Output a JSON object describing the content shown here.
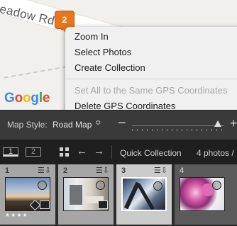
{
  "map": {
    "road_label": "eadow Rd",
    "road_label_tail": "G",
    "pin_count": "2",
    "provider_logo": "Google"
  },
  "context_menu": {
    "items": [
      {
        "label": "Zoom In",
        "enabled": true
      },
      {
        "label": "Select Photos",
        "enabled": true
      },
      {
        "label": "Create Collection",
        "enabled": true
      },
      {
        "label": "Set All to the Same GPS Coordinates",
        "enabled": false
      },
      {
        "label": "Delete GPS Coordinates",
        "enabled": true
      }
    ]
  },
  "map_toolbar": {
    "style_label": "Map Style:",
    "style_value": "Road Map",
    "style_arrows": "≎",
    "zoom_minus": "−",
    "zoom_plus": "+",
    "zoom_level": 0.93
  },
  "filmstrip": {
    "screen_buttons": [
      "1",
      "2"
    ],
    "back_arrow": "←",
    "forward_arrow": "→",
    "source": "Quick Collection",
    "count": "4 photos /",
    "thumbnails": [
      {
        "number": "1",
        "selected": false,
        "rating": "★★★★",
        "has_stars": true
      },
      {
        "number": "2",
        "selected": false,
        "rating": "",
        "has_stars": false
      },
      {
        "number": "3",
        "selected": true,
        "rating": "",
        "has_stars": false
      },
      {
        "number": "4",
        "selected": false,
        "rating": "",
        "has_stars": false
      }
    ]
  },
  "colors": {
    "pin_orange": "#e8761e",
    "menu_bg": "#f0f0f0",
    "toolbar_bg": "#3a3a3a",
    "filmstrip_bg": "#1f1f1f"
  }
}
